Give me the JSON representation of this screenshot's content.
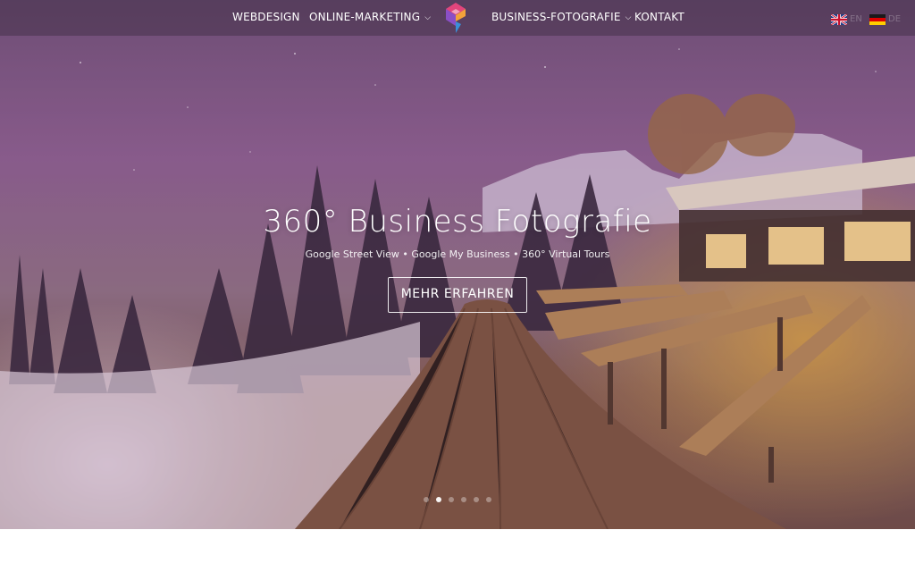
{
  "nav": {
    "items": [
      {
        "label": "WEBDESIGN",
        "dropdown": false
      },
      {
        "label": "ONLINE-MARKETING",
        "dropdown": true
      },
      {
        "label": "BUSINESS-FOTOGRAFIE",
        "dropdown": true
      },
      {
        "label": "KONTAKT",
        "dropdown": false
      }
    ],
    "dropdown_icon": "chevron-down-icon"
  },
  "languages": [
    {
      "code": "EN",
      "flag": "uk-flag-icon"
    },
    {
      "code": "DE",
      "flag": "german-flag-icon"
    }
  ],
  "hero": {
    "title": "360° Business Fotografie",
    "subtitle": "Google Street View • Google My Business • 360° Virtual Tours",
    "cta_label": "MEHR ERFAHREN"
  },
  "slider": {
    "total": 6,
    "active_index": 1
  },
  "colors": {
    "nav_bg": "#46324b",
    "logo_pink": "#e2457c",
    "logo_orange": "#f2a23a",
    "logo_blue": "#3a8fd8",
    "logo_purple": "#8a4fc6"
  }
}
